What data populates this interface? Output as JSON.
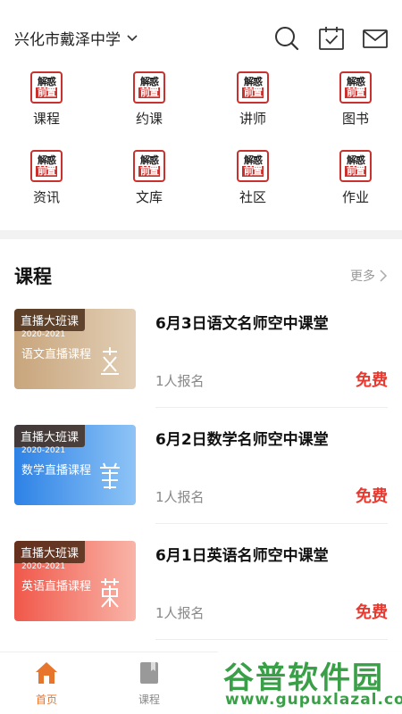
{
  "header": {
    "school": "兴化市戴泽中学"
  },
  "grid": [
    {
      "label": "课程",
      "logo1": "解惑",
      "logo2": "前置"
    },
    {
      "label": "约课",
      "logo1": "解惑",
      "logo2": "前置"
    },
    {
      "label": "讲师",
      "logo1": "解惑",
      "logo2": "前置"
    },
    {
      "label": "图书",
      "logo1": "解惑",
      "logo2": "前置"
    },
    {
      "label": "资讯",
      "logo1": "解惑",
      "logo2": "前置"
    },
    {
      "label": "文库",
      "logo1": "解惑",
      "logo2": "前置"
    },
    {
      "label": "社区",
      "logo1": "解惑",
      "logo2": "前置"
    },
    {
      "label": "作业",
      "logo1": "解惑",
      "logo2": "前置"
    }
  ],
  "section": {
    "title": "课程",
    "more": "更多"
  },
  "courses": [
    {
      "tag": "直播大班课",
      "year": "2020-2021",
      "subtitle": "语文直播课程",
      "title": "6月3日语文名师空中课堂",
      "enroll": "1人报名",
      "price": "免费"
    },
    {
      "tag": "直播大班课",
      "year": "2020-2021",
      "subtitle": "数学直播课程",
      "title": "6月2日数学名师空中课堂",
      "enroll": "1人报名",
      "price": "免费"
    },
    {
      "tag": "直播大班课",
      "year": "2020-2021",
      "subtitle": "英语直播课程",
      "title": "6月1日英语名师空中课堂",
      "enroll": "1人报名",
      "price": "免费"
    }
  ],
  "nav": [
    {
      "label": "首页"
    },
    {
      "label": "课程"
    }
  ],
  "watermark": {
    "text": "谷普软件园",
    "url": "www.gupuxlazal.com"
  },
  "colors": {
    "accent": "#e8752c",
    "price": "#e53a30",
    "logo": "#c8312d"
  }
}
